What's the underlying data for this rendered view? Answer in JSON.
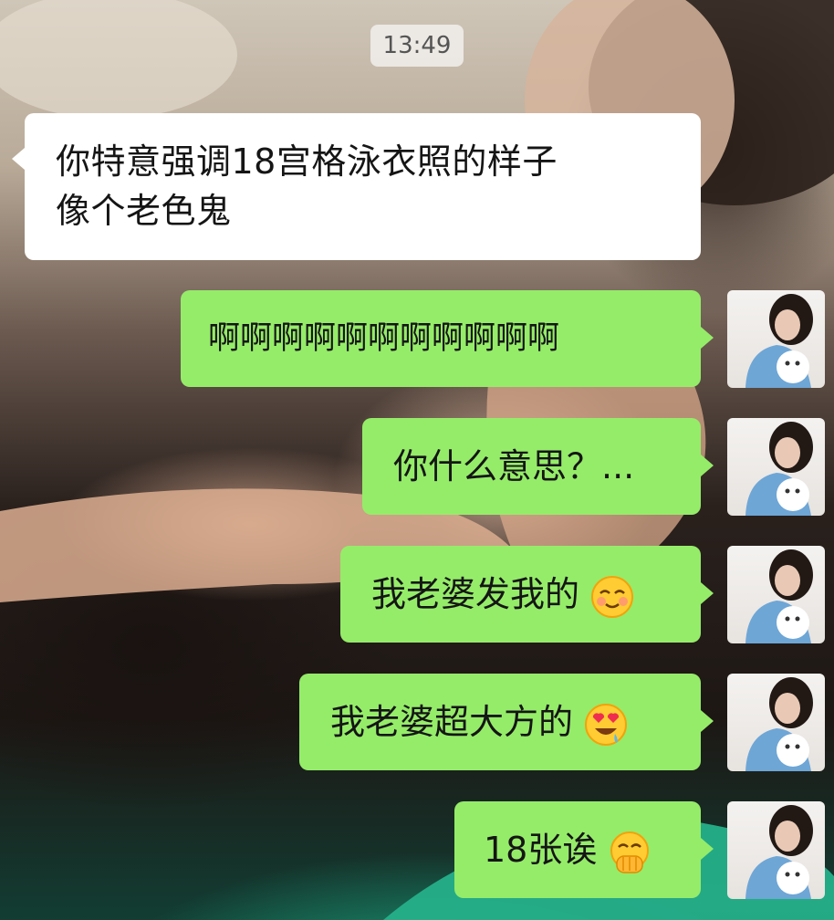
{
  "timestamp": "13:49",
  "messages": [
    {
      "side": "received",
      "lines": [
        "你特意强调18宫格泳衣照的样子",
        "像个老色鬼"
      ]
    },
    {
      "side": "sent",
      "text": "啊啊啊啊啊啊啊啊啊啊啊",
      "emoji": ""
    },
    {
      "side": "sent",
      "text": "你什么意思？...",
      "emoji": ""
    },
    {
      "side": "sent",
      "text": "我老婆发我的",
      "emoji": "smiling-blushing-face-icon"
    },
    {
      "side": "sent",
      "text": "我老婆超大方的",
      "emoji": "heart-eyes-drooling-face-icon"
    },
    {
      "side": "sent",
      "text": "18张诶",
      "emoji": "hand-over-mouth-face-icon"
    }
  ],
  "colors": {
    "sent_bubble": "#95ec69",
    "received_bubble": "#ffffff",
    "timestamp_chip": "#f0eeea"
  }
}
